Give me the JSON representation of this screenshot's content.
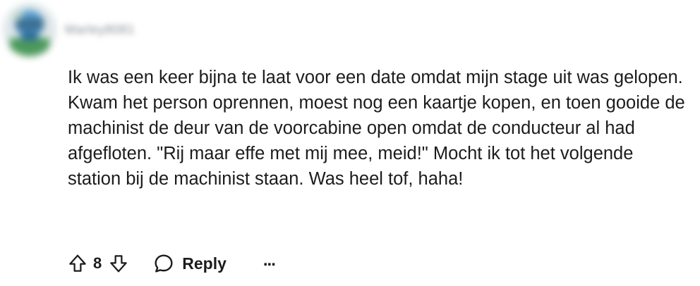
{
  "comment": {
    "author": "Marley8081",
    "body": "Ik was een keer bijna te laat voor een date omdat mijn stage uit was gelopen. Kwam het person oprennen, moest nog een kaartje kopen, en toen gooide de machinist de deur van de voorcabine open omdat de conducteur al had afgefloten. \"Rij maar effe met mij mee, meid!\" Mocht ik tot het volgende station bij de machinist staan. Was heel tof, haha!",
    "score": "8"
  },
  "actions": {
    "upvote_icon": "arrow-up-icon",
    "downvote_icon": "arrow-down-icon",
    "reply_icon": "speech-bubble-icon",
    "reply_label": "Reply",
    "more_label": "..."
  },
  "colors": {
    "text": "#1c1c1c",
    "muted": "#8a8f94"
  }
}
